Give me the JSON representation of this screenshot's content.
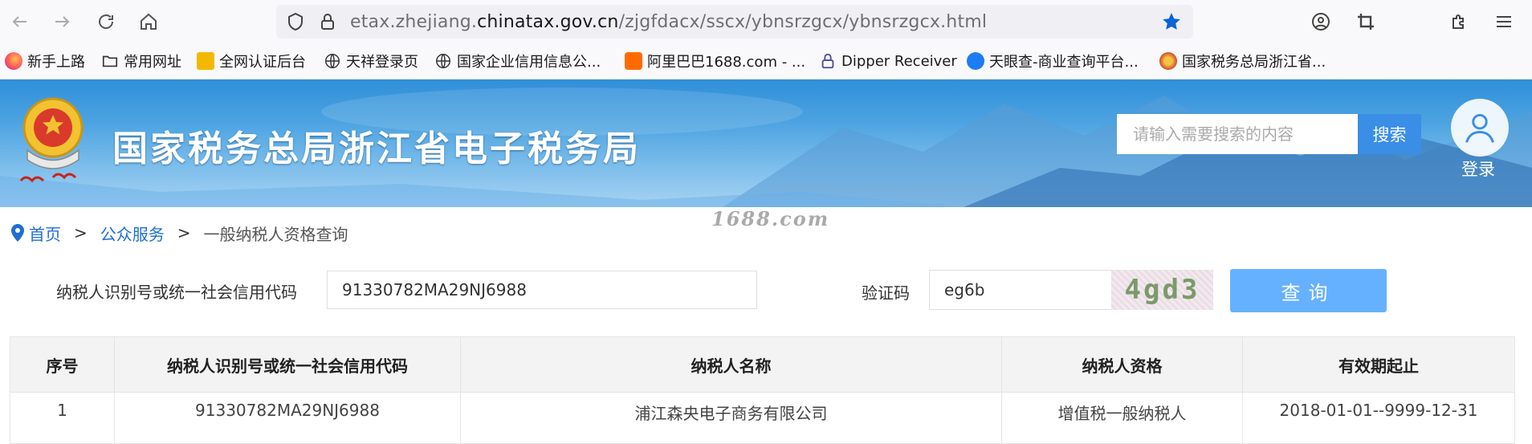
{
  "browser": {
    "url_prefix": "etax.zhejiang.",
    "url_domain": "chinatax.gov.cn",
    "url_path": "/zjgfdacx/sscx/ybnsrzgcx/ybnsrzgcx.html",
    "bookmarks": [
      {
        "label": "新手上路",
        "icon": "firefox-icon"
      },
      {
        "label": "常用网址",
        "icon": "folder-icon"
      },
      {
        "label": "全网认证后台",
        "icon": "cert-icon"
      },
      {
        "label": "天祥登录页",
        "icon": "globe-icon"
      },
      {
        "label": "国家企业信用信息公...",
        "icon": "globe-icon"
      },
      {
        "label": "阿里巴巴1688.com - ...",
        "icon": "alibaba-icon"
      },
      {
        "label": "Dipper Receiver",
        "icon": "lock-icon"
      },
      {
        "label": "天眼查-商业查询平台...",
        "icon": "tianyancha-icon"
      },
      {
        "label": "国家税务总局浙江省...",
        "icon": "tax-emblem-icon"
      }
    ]
  },
  "header": {
    "site_title": "国家税务总局浙江省电子税务局",
    "search_placeholder": "请输入需要搜索的内容",
    "search_button": "搜索",
    "login_label": "登录"
  },
  "breadcrumb": {
    "home": "首页",
    "separator": ">",
    "public_service": "公众服务",
    "current": "一般纳税人资格查询"
  },
  "watermark": "1688.com",
  "form": {
    "taxpayer_id_label": "纳税人识别号或统一社会信用代码",
    "taxpayer_id_value": "91330782MA29NJ6988",
    "captcha_label": "验证码",
    "captcha_value": "eg6b",
    "captcha_image_text": "4gd3",
    "query_button": "查询"
  },
  "table": {
    "headers": [
      "序号",
      "纳税人识别号或统一社会信用代码",
      "纳税人名称",
      "纳税人资格",
      "有效期起止"
    ],
    "rows": [
      [
        "1",
        "91330782MA29NJ6988",
        "浦江森央电子商务有限公司",
        "增值税一般纳税人",
        "2018-01-01--9999-12-31"
      ]
    ]
  },
  "colors": {
    "accent": "#1f6fd1",
    "search_button": "#3a8ee6",
    "query_button": "#66b1ff",
    "bookmark_star": "#0a64d6"
  }
}
